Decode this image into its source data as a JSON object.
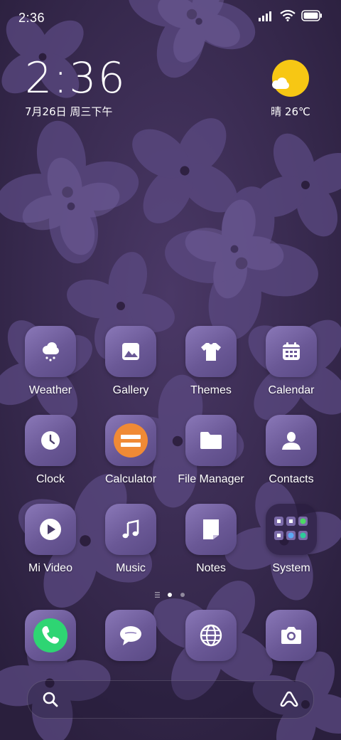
{
  "status_bar": {
    "time": "2:36"
  },
  "clock_widget": {
    "time": "2:36",
    "date": "7月26日 周三下午"
  },
  "weather_widget": {
    "text": "晴 26℃",
    "icon": "sun-cloud-icon",
    "sun_color": "#f7c714"
  },
  "apps": [
    {
      "label": "Weather",
      "icon": "weather-icon"
    },
    {
      "label": "Gallery",
      "icon": "gallery-icon"
    },
    {
      "label": "Themes",
      "icon": "themes-icon"
    },
    {
      "label": "Calendar",
      "icon": "calendar-icon"
    },
    {
      "label": "Clock",
      "icon": "clock-icon"
    },
    {
      "label": "Calculator",
      "icon": "calculator-icon"
    },
    {
      "label": "File Manager",
      "icon": "folder-icon"
    },
    {
      "label": "Contacts",
      "icon": "contacts-icon"
    },
    {
      "label": "Mi Video",
      "icon": "play-icon"
    },
    {
      "label": "Music",
      "icon": "music-icon"
    },
    {
      "label": "Notes",
      "icon": "notes-icon"
    },
    {
      "label": "System",
      "icon": "system-folder-icon"
    }
  ],
  "dock": [
    {
      "icon": "phone-icon"
    },
    {
      "icon": "messages-icon"
    },
    {
      "icon": "browser-icon"
    },
    {
      "icon": "camera-icon"
    }
  ],
  "page_indicator": {
    "pages": 2,
    "current": 1
  },
  "colors": {
    "accent_orange": "#f08a35",
    "phone_green": "#2ed573",
    "icon_purple": "#6a5896"
  }
}
